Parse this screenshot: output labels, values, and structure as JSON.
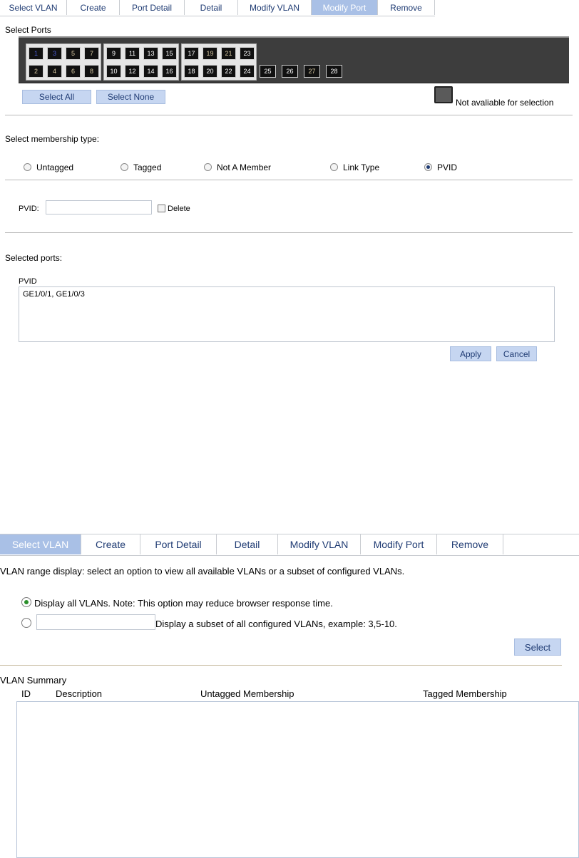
{
  "top": {
    "tabs": [
      "Select VLAN",
      "Create",
      "Port Detail",
      "Detail",
      "Modify VLAN",
      "Modify Port",
      "Remove"
    ],
    "active_tab": "Modify Port",
    "select_ports_label": "Select Ports",
    "ports_top_row": [
      "1",
      "3",
      "5",
      "7",
      "9",
      "11",
      "13",
      "15",
      "17",
      "19",
      "21",
      "23"
    ],
    "ports_bottom_row": [
      "2",
      "4",
      "6",
      "8",
      "10",
      "12",
      "14",
      "16",
      "18",
      "20",
      "22",
      "24"
    ],
    "ports_extra": [
      "25",
      "26",
      "27",
      "28"
    ],
    "selected_ports": [
      "1",
      "3"
    ],
    "select_all": "Select All",
    "select_none": "Select None",
    "legend_not_available": "Not avaliable for selection",
    "membership_label": "Select membership type:",
    "membership_options": [
      "Untagged",
      "Tagged",
      "Not A Member",
      "Link Type",
      "PVID"
    ],
    "membership_selected": "PVID",
    "pvid_label": "PVID:",
    "pvid_value": "",
    "delete_label": "Delete",
    "selected_ports_label": "Selected ports:",
    "selected_box_title": "PVID",
    "selected_ports_text": "GE1/0/1, GE1/0/3",
    "apply": "Apply",
    "cancel": "Cancel"
  },
  "bottom": {
    "tabs": [
      "Select VLAN",
      "Create",
      "Port Detail",
      "Detail",
      "Modify VLAN",
      "Modify Port",
      "Remove"
    ],
    "active_tab": "Select VLAN",
    "range_desc": "VLAN range display: select an option to view all available VLANs or a subset of configured VLANs.",
    "option_all": "Display all VLANs. Note: This option may reduce browser response time.",
    "option_subset": "Display a subset of all configured VLANs, example: 3,5-10.",
    "subset_value": "",
    "select_button": "Select",
    "summary_title": "VLAN Summary",
    "columns": [
      "ID",
      "Description",
      "Untagged Membership",
      "Tagged Membership"
    ]
  },
  "colors": {
    "accent": "#a9c0e6",
    "button_bg": "#c6d6f1",
    "link_text": "#1f3b73",
    "panel": "#3d3d3d"
  }
}
